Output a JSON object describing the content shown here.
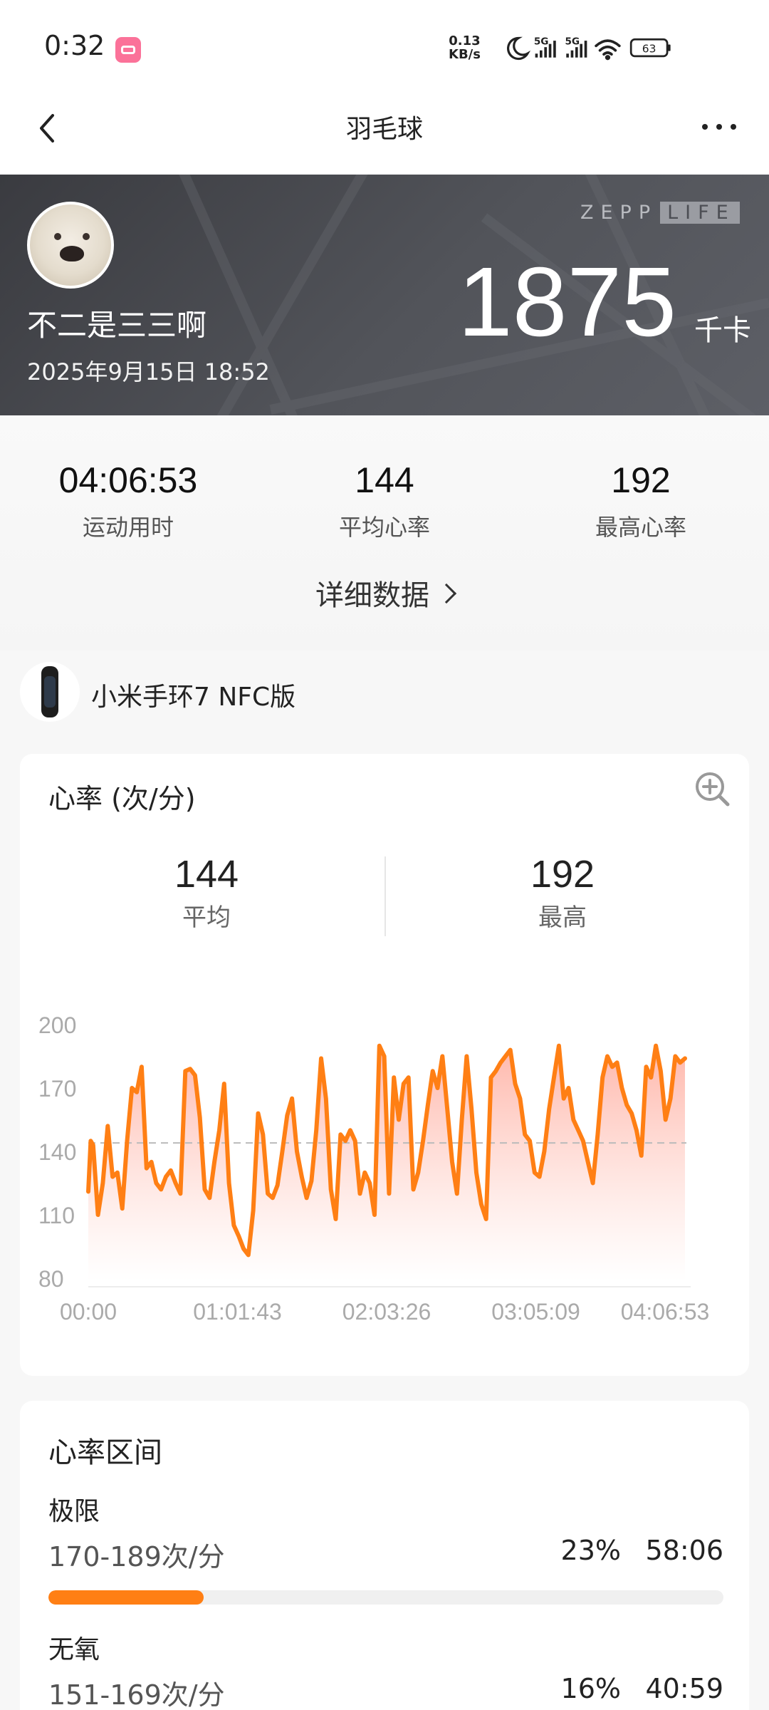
{
  "status_bar": {
    "time": "0:32",
    "net_speed_value": "0.13",
    "net_speed_unit": "KB/s",
    "signal1": "5G",
    "signal2": "5G",
    "battery": "63"
  },
  "nav": {
    "title": "羽毛球"
  },
  "banner": {
    "user_name": "不二是三三啊",
    "date": "2025年9月15日 18:52",
    "brand_left": "ZEPP",
    "brand_right": "LIFE",
    "calories": "1875",
    "calorie_unit": "千卡"
  },
  "summary": {
    "items": [
      {
        "value": "04:06:53",
        "label": "运动用时"
      },
      {
        "value": "144",
        "label": "平均心率"
      },
      {
        "value": "192",
        "label": "最高心率"
      }
    ],
    "detail_link": "详细数据"
  },
  "device": {
    "name": "小米手环7 NFC版"
  },
  "heart_rate_card": {
    "title": "心率 (次/分)",
    "avg_value": "144",
    "avg_label": "平均",
    "max_value": "192",
    "max_label": "最高"
  },
  "chart_data": {
    "type": "area",
    "title": "",
    "xlabel": "",
    "ylabel": "",
    "ylim": [
      80,
      200
    ],
    "yticks": [
      "200",
      "170",
      "140",
      "110",
      "80"
    ],
    "xticks": [
      "00:00",
      "01:01:43",
      "02:03:26",
      "03:05:09",
      "04:06:53"
    ],
    "average_line": 144,
    "colors": {
      "line": "#ff7f14",
      "fill_top": "#ffb3a6",
      "fill_bottom": "#ffffff",
      "avg_line": "#bbbbbb"
    },
    "series": [
      {
        "x_minutes": [
          0,
          1,
          2,
          4,
          6,
          8,
          10,
          12,
          14,
          16,
          18,
          20,
          22,
          24,
          26,
          28,
          30,
          32,
          34,
          36,
          38,
          40,
          42,
          44,
          46,
          48,
          50,
          52,
          54,
          56,
          58,
          60,
          62,
          64,
          66,
          68,
          70,
          72,
          74,
          76,
          78,
          80,
          82,
          84,
          86,
          88,
          90,
          92,
          94,
          96,
          98,
          100,
          102,
          104,
          106,
          108,
          110,
          112,
          114,
          116,
          118,
          120,
          122,
          124,
          126,
          128,
          130,
          132,
          134,
          136,
          138,
          140,
          142,
          144,
          146,
          148,
          150,
          152,
          154,
          156,
          158,
          160,
          162,
          164,
          166,
          168,
          170,
          172,
          174,
          176,
          178,
          180,
          182,
          184,
          186,
          188,
          190,
          192,
          194,
          196,
          198,
          200,
          202,
          204,
          206,
          208,
          210,
          212,
          214,
          216,
          218,
          220,
          222,
          224,
          226,
          228,
          230,
          232,
          234,
          236,
          238,
          240,
          242,
          244,
          246
        ],
        "values": [
          121,
          145,
          143,
          110,
          125,
          152,
          128,
          130,
          113,
          145,
          170,
          168,
          180,
          132,
          135,
          125,
          122,
          128,
          131,
          125,
          120,
          178,
          179,
          176,
          156,
          122,
          118,
          135,
          150,
          172,
          125,
          105,
          100,
          94,
          91,
          112,
          158,
          148,
          120,
          118,
          124,
          140,
          157,
          165,
          140,
          128,
          118,
          126,
          150,
          184,
          165,
          122,
          108,
          148,
          145,
          150,
          145,
          120,
          130,
          125,
          110,
          190,
          185,
          120,
          175,
          155,
          172,
          175,
          122,
          130,
          145,
          162,
          178,
          170,
          185,
          160,
          135,
          120,
          155,
          185,
          160,
          130,
          115,
          108,
          175,
          178,
          182,
          185,
          188,
          172,
          165,
          148,
          145,
          130,
          128,
          140,
          160,
          175,
          190,
          165,
          170,
          155,
          150,
          145,
          135,
          125,
          148,
          175,
          185,
          180,
          182,
          170,
          162,
          158,
          150,
          138,
          180,
          175,
          190,
          178,
          155,
          165,
          185,
          182,
          184
        ]
      }
    ]
  },
  "zone_card": {
    "title": "心率区间",
    "zones": [
      {
        "name": "极限",
        "range": "170-189次/分",
        "percent": "23%",
        "time": "58:06",
        "fill_fraction": 0.23
      },
      {
        "name": "无氧",
        "range": "151-169次/分",
        "percent": "16%",
        "time": "40:59",
        "fill_fraction": 0.16
      }
    ]
  }
}
